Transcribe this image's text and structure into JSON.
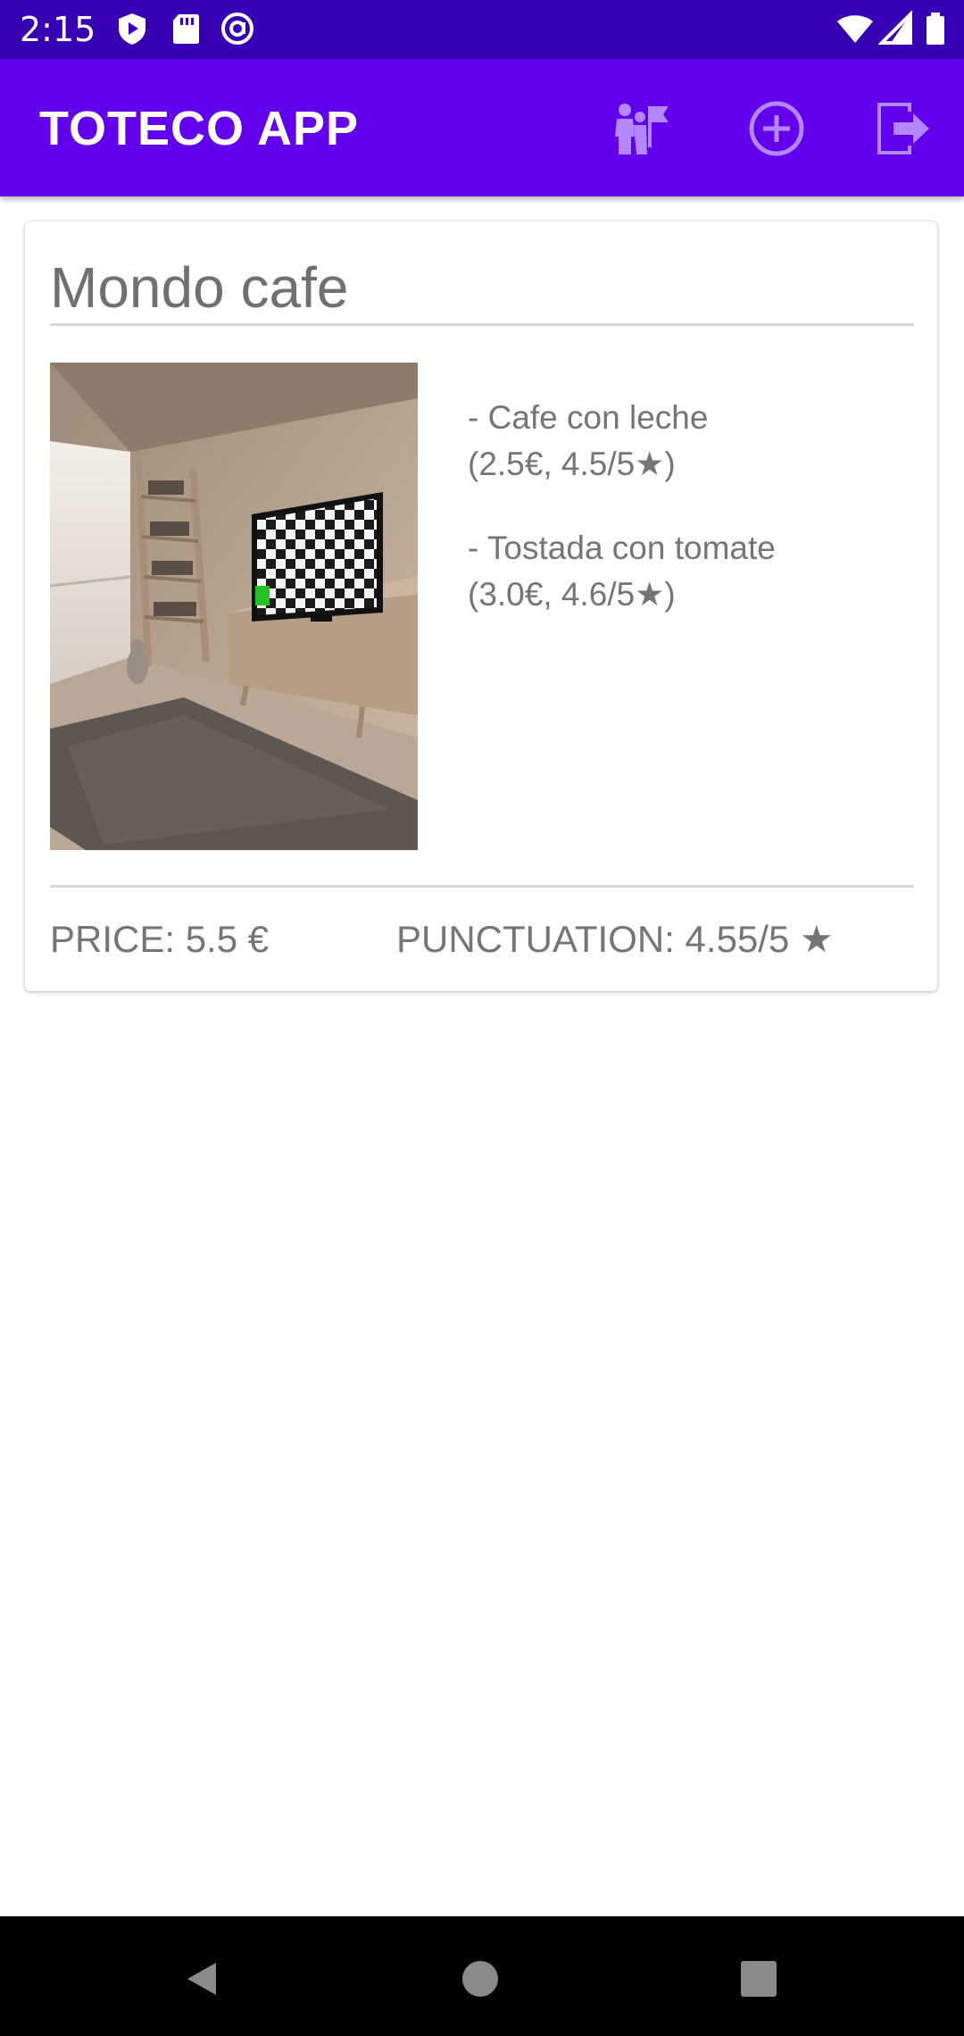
{
  "status_bar": {
    "time": "2:15",
    "icons": [
      "play-protect-icon",
      "sd-card-icon",
      "at-sign-icon",
      "wifi-icon",
      "cell-signal-icon",
      "battery-icon"
    ]
  },
  "app_bar": {
    "title": "TOTECO APP",
    "actions": [
      "tour-guide-flag-icon",
      "add-circle-icon",
      "logout-icon"
    ],
    "background_color": "#6200ee",
    "icon_color": "#b388ff"
  },
  "card": {
    "title": "Mondo cafe",
    "products": [
      {
        "name": "- Cafe con leche",
        "detail": "(2.5€, 4.5/5★)"
      },
      {
        "name": "- Tostada con tomate",
        "detail": "(3.0€, 4.6/5★)"
      }
    ],
    "price_text": "PRICE: 5.5 €",
    "punctuation_text": "PUNCTUATION: 4.55/5 ★"
  },
  "nav_bar": {
    "buttons": [
      "back-icon",
      "home-icon",
      "recents-icon"
    ]
  }
}
